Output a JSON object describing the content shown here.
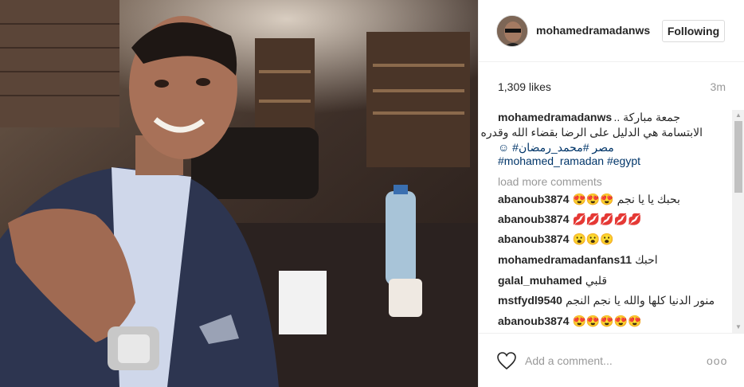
{
  "header": {
    "username": "mohamedramadanws",
    "follow_label": "Following"
  },
  "stats": {
    "likes": "1,309 likes",
    "time": "3m"
  },
  "caption": {
    "username": "mohamedramadanws",
    "line1": "جمعة مباركة ..",
    "line2": "الابتسامة هي الدليل على الرضا بقضاء الله وقدره ❤",
    "line3": "☺ #مصر #محمد_رمضان",
    "line4": "#mohamed_ramadan #egypt"
  },
  "load_more": "load more comments",
  "comments": [
    {
      "user": "abanoub3874",
      "text": "😍😍😍 بحبك يا يا نجم"
    },
    {
      "user": "abanoub3874",
      "text": "💋💋💋💋💋"
    },
    {
      "user": "abanoub3874",
      "text": "😮😮😮"
    },
    {
      "user": "mohamedramadanfans11",
      "text": "احبك"
    },
    {
      "user": "galal_muhamed",
      "text": "قلبي"
    },
    {
      "user": "mstfydl9540",
      "text": "منور الدنيا كلها والله يا نجم النجم"
    },
    {
      "user": "abanoub3874",
      "text": "😍😍😍😍😍"
    }
  ],
  "footer": {
    "comment_placeholder": "Add a comment...",
    "more_label": "ooo"
  },
  "colors": {
    "hashtag": "#003569",
    "muted": "#999999",
    "border": "#efefef"
  }
}
